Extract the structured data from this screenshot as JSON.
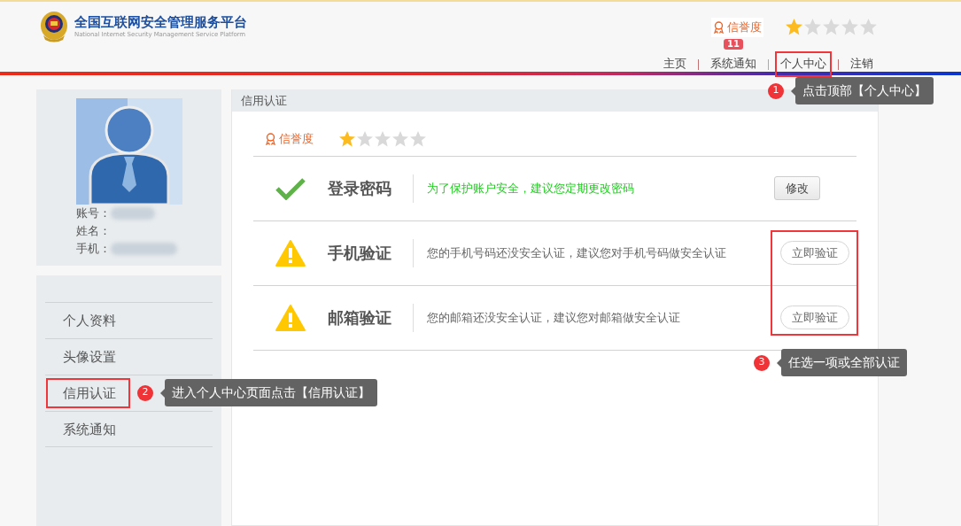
{
  "header": {
    "title": "全国互联网安全管理服务平台",
    "subtitle": "National Internet Security Management Service Platform",
    "credit_label": "信誉度",
    "stars": 1
  },
  "nav": [
    {
      "label": "主页",
      "highlighted": false
    },
    {
      "label": "系统通知",
      "badge": "11",
      "highlighted": false
    },
    {
      "label": "个人中心",
      "highlighted": true
    },
    {
      "label": "注销",
      "highlighted": false
    }
  ],
  "profile": {
    "fields": [
      {
        "label": "账号：",
        "redacted": true
      },
      {
        "label": "姓名：",
        "redacted": false
      },
      {
        "label": "手机：",
        "redacted": true
      }
    ]
  },
  "sidebar": {
    "items": [
      {
        "label": "个人资料",
        "highlighted": false
      },
      {
        "label": "头像设置",
        "highlighted": false
      },
      {
        "label": "信用认证",
        "highlighted": true
      },
      {
        "label": "系统通知",
        "highlighted": false
      }
    ]
  },
  "panel": {
    "title": "信用认证",
    "credit_label": "信誉度",
    "stars": 1,
    "buttons_highlighted": true,
    "rows": [
      {
        "kind": "verified",
        "title": "登录密码",
        "description": "为了保护账户安全，建议您定期更改密码",
        "button": "修改"
      },
      {
        "kind": "unverified",
        "title": "手机验证",
        "description": "您的手机号码还没安全认证，建议您对手机号码做安全认证",
        "button": "立即验证"
      },
      {
        "kind": "unverified",
        "title": "邮箱验证",
        "description": "您的邮箱还没安全认证，建议您对邮箱做安全认证",
        "button": "立即验证"
      }
    ]
  },
  "annotations": [
    {
      "number": "1",
      "text": "点击顶部【个人中心】"
    },
    {
      "number": "2",
      "text": "进入个人中心页面点击【信用认证】"
    },
    {
      "number": "3",
      "text": "任选一项或全部认证"
    }
  ]
}
